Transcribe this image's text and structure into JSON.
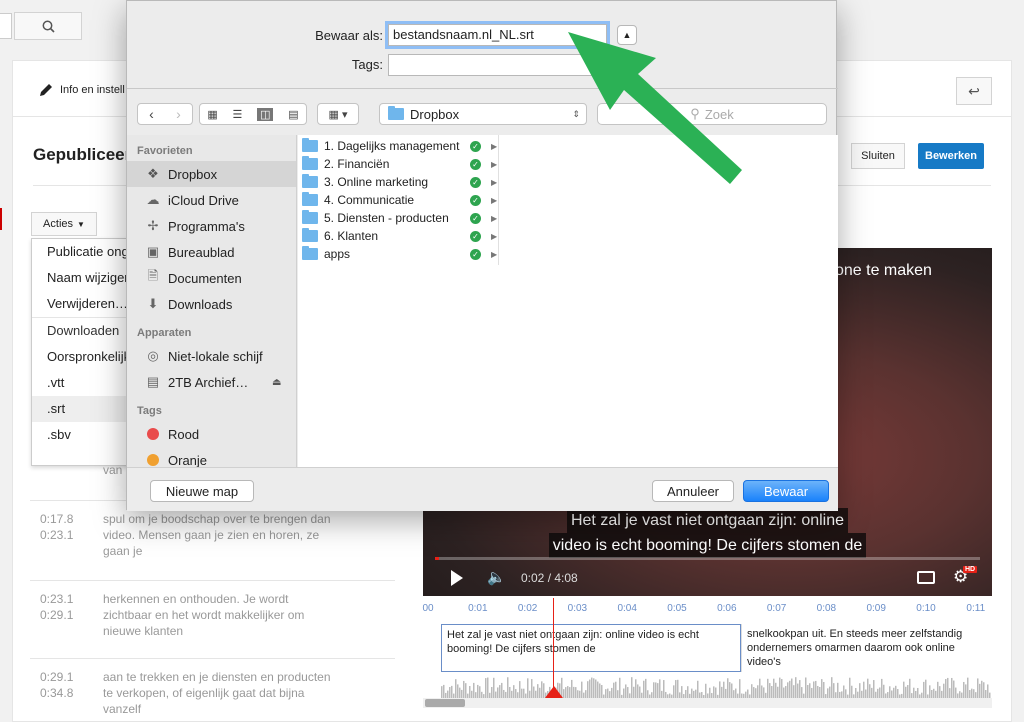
{
  "yt": {
    "info_tab": "Info en instell",
    "published": "Gepubliceer",
    "close": "Sluiten",
    "edit": "Bewerken",
    "actions": "Acties",
    "menu": [
      "Publicatie ong",
      "Naam wijziger",
      "Verwijderen…",
      "Downloaden",
      "Oorspronkelijk",
      ".vtt",
      ".srt",
      ".sbv"
    ],
    "subtitles": [
      {
        "times": "",
        "text": "van"
      },
      {
        "times": "0:17.8\n0:23.1",
        "text": "spul om je boodschap over te brengen dan video. Mensen gaan je zien en horen, ze gaan je"
      },
      {
        "times": "0:23.1\n0:29.1",
        "text": "herkennen en onthouden. Je wordt zichtbaar en het wordt makkelijker om nieuwe klanten"
      },
      {
        "times": "0:29.1\n0:34.8",
        "text": "aan te trekken en je diensten en producten te verkopen, of eigenlijk gaat dat bijna vanzelf"
      }
    ]
  },
  "video": {
    "top_text": "one te maken",
    "caption_line1": "Het zal je vast niet ontgaan zijn: online",
    "caption_line2": "video is echt booming! De cijfers stomen de",
    "time": "0:02 / 4:08",
    "progress": 0.008,
    "hd": "HD"
  },
  "timeline": {
    "ticks": [
      "00",
      "0:01",
      "0:02",
      "0:03",
      "0:04",
      "0:05",
      "0:06",
      "0:07",
      "0:08",
      "0:09",
      "0:10",
      "0:11"
    ],
    "cap1": "Het zal je vast niet ontgaan zijn: online video is echt booming! De cijfers stomen de",
    "cap2": "snelkookpan uit. En steeds meer zelfstandig ondernemers omarmen daarom ook online video's"
  },
  "dialog": {
    "save_as_label": "Bewaar als:",
    "filename": "bestandsnaam.nl_NL.srt",
    "tags_label": "Tags:",
    "tags_value": "",
    "location": "Dropbox",
    "search_placeholder": "Zoek",
    "sidebar": {
      "favorites_header": "Favorieten",
      "favorites": [
        "Dropbox",
        "iCloud Drive",
        "Programma's",
        "Bureaublad",
        "Documenten",
        "Downloads"
      ],
      "devices_header": "Apparaten",
      "devices": [
        "Niet-lokale schijf",
        "2TB Archief…"
      ],
      "tags_header": "Tags",
      "tags": [
        {
          "label": "Rood",
          "color": "#e94b4b"
        },
        {
          "label": "Oranje",
          "color": "#f0a030"
        }
      ]
    },
    "files": [
      "1. Dagelijks management",
      "2. Financiën",
      "3. Online marketing",
      "4. Communicatie",
      "5. Diensten - producten",
      "6. Klanten",
      "apps"
    ],
    "new_folder": "Nieuwe map",
    "cancel": "Annuleer",
    "save": "Bewaar"
  },
  "colors": {
    "accent": "#167ac6",
    "arrow": "#2bb155",
    "sync": "#2ea44f"
  }
}
